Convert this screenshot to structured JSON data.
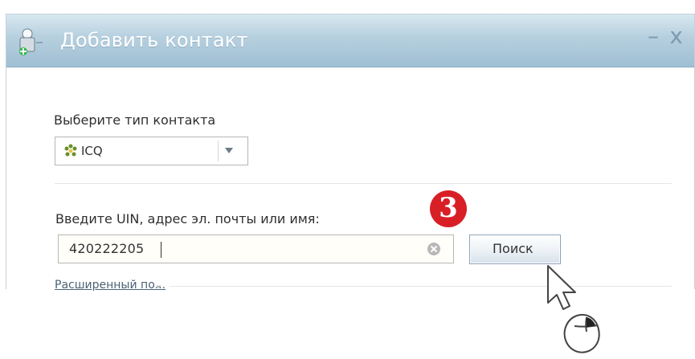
{
  "window": {
    "title": "Добавить контакт",
    "controls": {
      "minimize": "–",
      "close": "x"
    }
  },
  "form": {
    "contact_type_label": "Выберите тип контакта",
    "selected_type": "ICQ",
    "search_label": "Введите UIN, адрес эл. почты или имя:",
    "search_value": "420222205",
    "search_button": "Поиск",
    "advanced_link": "Расширенный по...",
    "step_number": "3"
  },
  "icons": {
    "app": "add-contact-icon",
    "type": "flower-icon",
    "dropdown": "chevron-down-icon",
    "clear": "clear-icon",
    "cursor": "cursor-icon"
  },
  "colors": {
    "titlebar": "#b7d0df",
    "accent": "#d91f26",
    "link": "#4d6274"
  }
}
